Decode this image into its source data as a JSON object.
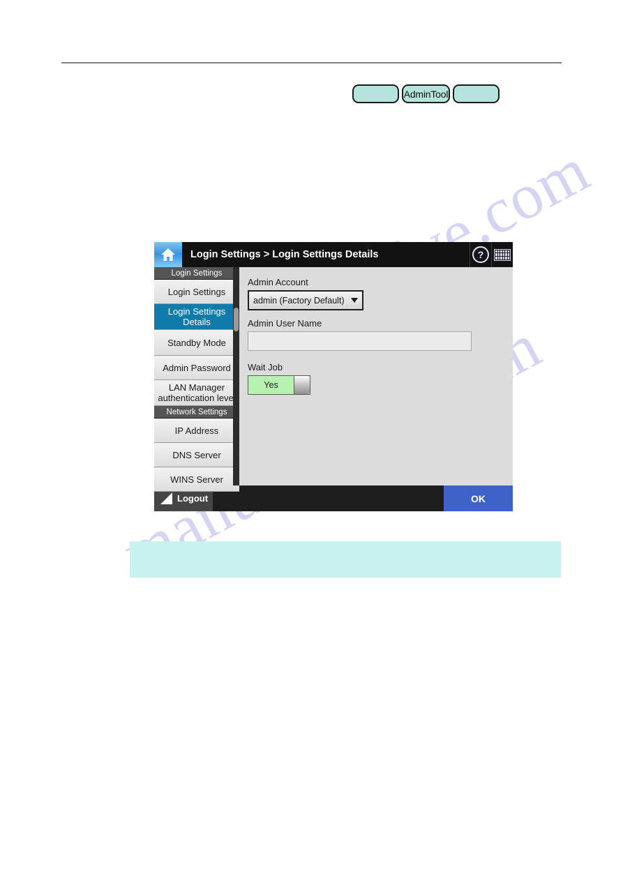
{
  "page": {
    "watermark": [
      "manualshive.com",
      "manualshive.com"
    ]
  },
  "pill_buttons": [
    {
      "label": "",
      "name": "pill-button-blank-left"
    },
    {
      "label": "AdminTool",
      "name": "pill-button-admintool"
    },
    {
      "label": "",
      "name": "pill-button-blank-right"
    }
  ],
  "device": {
    "header": {
      "home_icon": "home-icon",
      "title": "Login Settings > Login Settings Details",
      "help_icon": "help-icon",
      "help_glyph": "?",
      "keyboard_icon": "keyboard-icon"
    },
    "sidebar": {
      "groups": [
        {
          "title": "Login Settings",
          "items": [
            {
              "label": "Login Settings",
              "active": false
            },
            {
              "label": "Login Settings Details",
              "active": true
            },
            {
              "label": "Standby Mode",
              "active": false
            },
            {
              "label": "Admin Password",
              "active": false
            },
            {
              "label": "LAN Manager authentication level",
              "active": false
            }
          ]
        },
        {
          "title": "Network Settings",
          "items": [
            {
              "label": "IP Address",
              "active": false
            },
            {
              "label": "DNS Server",
              "active": false
            },
            {
              "label": "WINS Server",
              "active": false
            }
          ]
        }
      ],
      "scrollbar": "vertical-scrollbar"
    },
    "content": {
      "admin_account_label": "Admin Account",
      "admin_account_value": "admin (Factory Default)",
      "admin_user_name_label": "Admin User Name",
      "admin_user_name_value": "",
      "admin_user_name_placeholder": "",
      "wait_job_label": "Wait Job",
      "wait_job_value": "Yes"
    },
    "footer": {
      "logout_label": "Logout",
      "ok_label": "OK"
    }
  },
  "colors": {
    "accent_blue": "#0f7bab",
    "ok_blue": "#3f62c8",
    "toggle_green": "#b7f2b0",
    "pill_teal": "#b5e4dd",
    "note_teal": "#c8f2f0"
  }
}
